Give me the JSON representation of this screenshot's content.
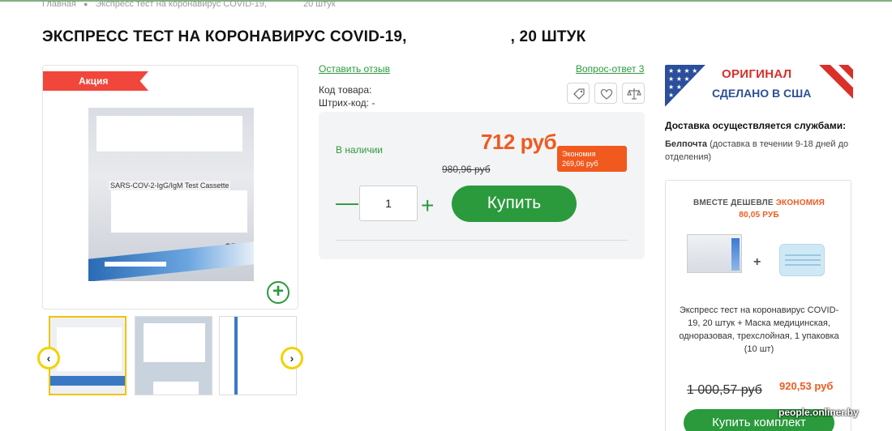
{
  "breadcrumb": {
    "home": "Главная",
    "current": "Экспресс тест на коронавирус COVID-19,",
    "count": "20 штук"
  },
  "product": {
    "title": "ЭКСПРЕСС ТЕСТ НА КОРОНАВИРУС COVID-19,",
    "title_suffix": ", 20 ШТУК",
    "promo_badge": "Акция",
    "image_label": "SARS-COV-2-IgG/IgM Test Cassette",
    "image_mark": "CE",
    "review_link": "Оставить отзыв",
    "qa_link": "Вопрос-ответ 3",
    "code_label": "Код товара:",
    "barcode_label": "Штрих-код: -"
  },
  "icons": [
    "tag-icon",
    "heart-icon",
    "scales-icon"
  ],
  "pricing": {
    "stock": "В наличии",
    "price": "712 руб",
    "old_price": "980,96 руб",
    "save_label": "Экономия",
    "save_amount": "269,06 руб",
    "qty": "1",
    "minus": "—",
    "plus": "+",
    "buy_label": "Купить"
  },
  "banner": {
    "line1": "ОРИГИНАЛ",
    "line2": "СДЕЛАНО В США"
  },
  "delivery": {
    "title": "Доставка осуществляется службами:",
    "service": "Белпочта",
    "details": "(доставка в течении 9-18 дней до отделения)"
  },
  "bundle": {
    "head1": "ВМЕСТЕ ДЕШЕВЛЕ",
    "head_accent": "ЭКОНОМИЯ",
    "head2": "80,05 РУБ",
    "plus": "+",
    "desc": "Экспресс тест на коронавирус COVID-19, 20 штук + Маска медицинская, одноразовая, трехслойная, 1 упаковка (10 шт)",
    "old_price": "1 000,57 руб",
    "new_price": "920,53 руб",
    "button": "Купить комплект"
  },
  "gallery": {
    "zoom": "+",
    "prev": "‹",
    "next": "›"
  },
  "watermark": "people.onliner.by",
  "colors": {
    "accent_green": "#2a9a3c",
    "price_orange": "#f05a1e",
    "promo_red": "#f0463c"
  }
}
